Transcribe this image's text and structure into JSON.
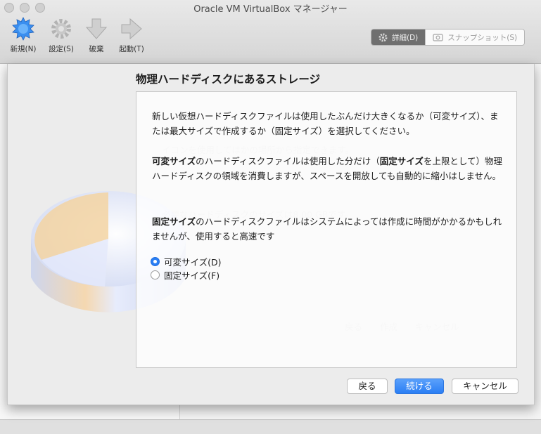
{
  "window": {
    "title": "Oracle VM VirtualBox マネージャー"
  },
  "toolbar": {
    "new_label": "新規(N)",
    "settings_label": "設定(S)",
    "discard_label": "破棄",
    "start_label": "起動(T)"
  },
  "view_tabs": {
    "details_label": "詳細(D)",
    "snapshots_label": "スナップショット(S)"
  },
  "dialog": {
    "heading": "物理ハードディスクにあるストレージ",
    "paragraph1": "新しい仮想ハードディスクファイルは使用したぶんだけ大きくなるか（可変サイズ）、または最大サイズで作成するか（固定サイズ）を選択してください。",
    "p2_bold": "可変サイズ",
    "p2_mid": "のハードディスクファイルは使用した分だけ（",
    "p2_bold2": "固定サイズ",
    "p2_rest": "を上限として）物理ハードディスクの領域を消費しますが、スペースを開放しても自動的に縮小はしません。",
    "p3_bold": "固定サイズ",
    "p3_rest": "のハードディスクファイルはシステムによっては作成に時間がかかるかもしれませんが、使用すると高速です",
    "options": [
      {
        "label": "可変サイズ(D)",
        "selected": true
      },
      {
        "label": "固定サイズ(F)",
        "selected": false
      }
    ],
    "back_label": "戻る",
    "continue_label": "続ける",
    "cancel_label": "キャンセル"
  },
  "colors": {
    "accent": "#2a7ef4"
  }
}
